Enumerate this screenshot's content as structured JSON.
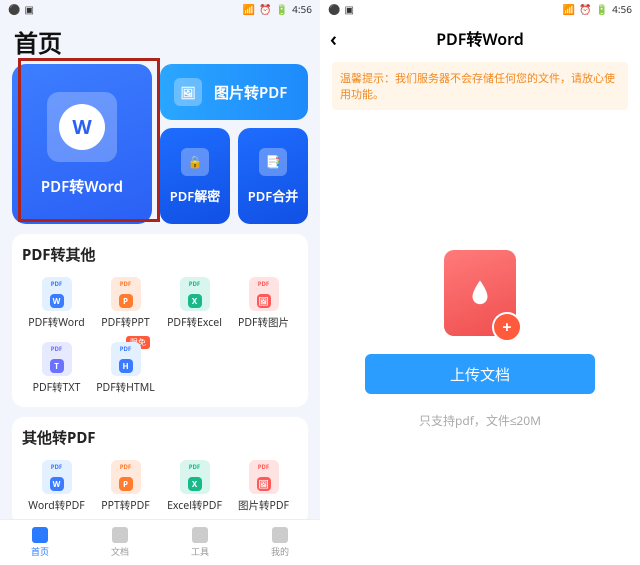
{
  "statusbar": {
    "time": "4:56"
  },
  "left": {
    "title": "首页",
    "hero": {
      "big": "PDF转Word",
      "wide": "图片转PDF",
      "sm1": "PDF解密",
      "sm2": "PDF合并"
    },
    "sec1": {
      "title": "PDF转其他",
      "items": [
        "PDF转Word",
        "PDF转PPT",
        "PDF转Excel",
        "PDF转图片",
        "PDF转TXT",
        "PDF转HTML"
      ],
      "badge_free": "限免"
    },
    "sec2": {
      "title": "其他转PDF",
      "items": [
        "Word转PDF",
        "PPT转PDF",
        "Excel转PDF",
        "图片转PDF"
      ]
    },
    "nav": [
      "首页",
      "文档",
      "工具",
      "我的"
    ]
  },
  "right": {
    "title": "PDF转Word",
    "tip": "温馨提示：我们服务器不会存储任何您的文件，请放心使用功能。",
    "upload_btn": "上传文档",
    "hint": "只支持pdf，文件≤20M"
  }
}
